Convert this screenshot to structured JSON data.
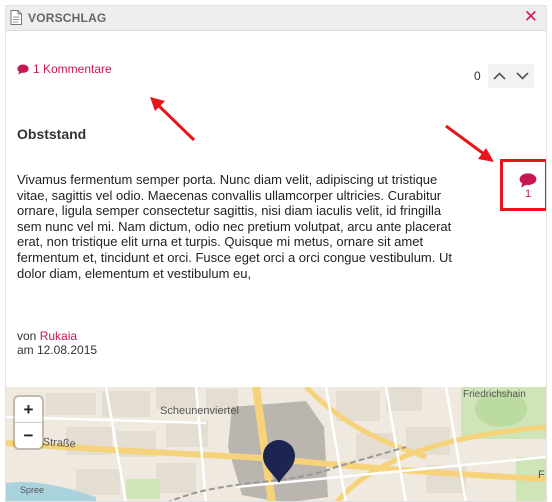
{
  "header": {
    "title": "VORSCHLAG",
    "close_icon": "close-icon"
  },
  "comments": {
    "label": "1 Kommentare",
    "icon": "comment-bubble-icon"
  },
  "vote": {
    "count": "0",
    "up_icon": "chevron-up-icon",
    "down_icon": "chevron-down-icon"
  },
  "proposal": {
    "title": "Obststand",
    "body": "Vivamus fermentum semper porta. Nunc diam velit, adipiscing ut tristique vitae, sagittis vel odio. Maecenas convallis ullamcorper ultricies. Curabitur ornare, ligula semper consectetur sagittis, nisi diam iaculis velit, id fringilla sem nunc vel mi. Nam dictum, odio nec pretium volutpat, arcu ante placerat erat, non tristique elit urna et turpis. Quisque mi metus, ornare sit amet fermentum et, tincidunt et orci. Fusce eget orci a orci congue vestibulum. Ut dolor diam, elementum et vestibulum eu,",
    "comment_badge_count": "1",
    "by_prefix": "von",
    "author": "Rukaia",
    "date": "am 12.08.2015"
  },
  "map": {
    "zoom_in": "+",
    "zoom_out": "−",
    "labels": {
      "district": "Scheunenviertel",
      "street_left": "r Straße",
      "river": "Spree",
      "street_right": "Friedrichshain",
      "edge_f": "F"
    },
    "marker_color": "#1c2452"
  },
  "colors": {
    "accent": "#c8174f",
    "annotation": "#e8141c"
  }
}
